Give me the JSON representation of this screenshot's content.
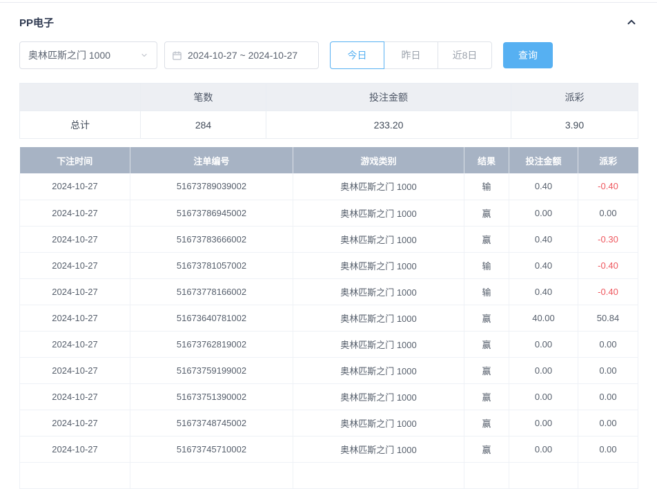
{
  "colors": {
    "accent_blue": "#56b0f2",
    "negative_red": "#ee565d",
    "table_header_bg": "#a7b3c4",
    "title_color": "#2e3950"
  },
  "header": {
    "title": "PP电子"
  },
  "filters": {
    "game_select": {
      "value": "奥林匹斯之门 1000"
    },
    "date_range": {
      "value": "2024-10-27 ~ 2024-10-27"
    },
    "quick_ranges": [
      {
        "label": "今日",
        "active": true
      },
      {
        "label": "昨日",
        "active": false
      },
      {
        "label": "近8日",
        "active": false
      }
    ],
    "query_button_label": "查询"
  },
  "summary": {
    "headers": [
      "",
      "笔数",
      "投注金额",
      "派彩"
    ],
    "total_row": {
      "label": "总计",
      "count": "284",
      "bet_amount": "233.20",
      "payout": "3.90"
    }
  },
  "bet_table": {
    "headers": [
      "下注时间",
      "注单编号",
      "游戏类别",
      "结果",
      "投注金额",
      "派彩"
    ],
    "rows": [
      [
        "2024-10-27",
        "51673789039002",
        "奥林匹斯之门 1000",
        "输",
        "0.40",
        "-0.40"
      ],
      [
        "2024-10-27",
        "51673786945002",
        "奥林匹斯之门 1000",
        "赢",
        "0.00",
        "0.00"
      ],
      [
        "2024-10-27",
        "51673783666002",
        "奥林匹斯之门 1000",
        "赢",
        "0.40",
        "-0.30"
      ],
      [
        "2024-10-27",
        "51673781057002",
        "奥林匹斯之门 1000",
        "输",
        "0.40",
        "-0.40"
      ],
      [
        "2024-10-27",
        "51673778166002",
        "奥林匹斯之门 1000",
        "输",
        "0.40",
        "-0.40"
      ],
      [
        "2024-10-27",
        "51673640781002",
        "奥林匹斯之门 1000",
        "赢",
        "40.00",
        "50.84"
      ],
      [
        "2024-10-27",
        "51673762819002",
        "奥林匹斯之门 1000",
        "赢",
        "0.00",
        "0.00"
      ],
      [
        "2024-10-27",
        "51673759199002",
        "奥林匹斯之门 1000",
        "赢",
        "0.00",
        "0.00"
      ],
      [
        "2024-10-27",
        "51673751390002",
        "奥林匹斯之门 1000",
        "赢",
        "0.00",
        "0.00"
      ],
      [
        "2024-10-27",
        "51673748745002",
        "奥林匹斯之门 1000",
        "赢",
        "0.00",
        "0.00"
      ],
      [
        "2024-10-27",
        "51673745710002",
        "奥林匹斯之门 1000",
        "赢",
        "0.00",
        "0.00"
      ]
    ]
  }
}
